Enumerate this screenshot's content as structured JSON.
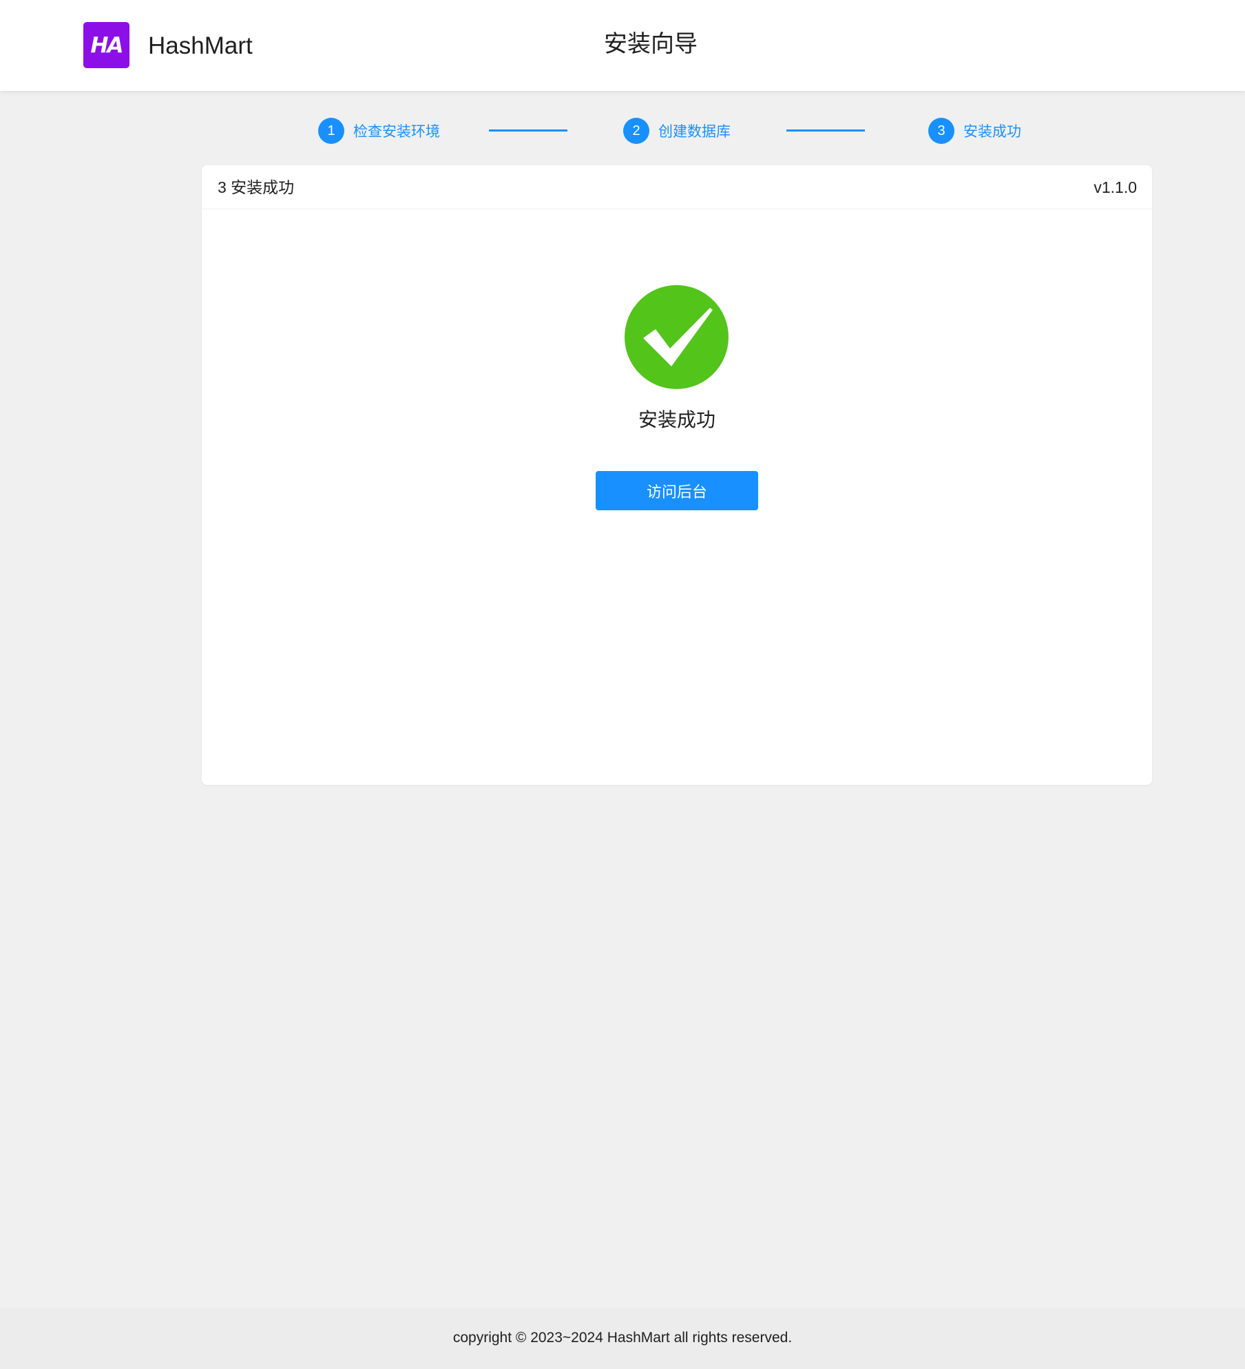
{
  "header": {
    "logo_text": "HA",
    "brand": "HashMart",
    "title": "安装向导"
  },
  "steps": [
    {
      "number": "1",
      "label": "检查安装环境"
    },
    {
      "number": "2",
      "label": "创建数据库"
    },
    {
      "number": "3",
      "label": "安装成功"
    }
  ],
  "card": {
    "title": "3 安装成功",
    "version": "v1.1.0",
    "success_text": "安装成功",
    "button_label": "访问后台"
  },
  "footer": {
    "copyright": "copyright © 2023~2024 HashMart all rights reserved."
  },
  "icons": {
    "success": "check-circle-icon"
  },
  "colors": {
    "primary": "#1890ff",
    "success": "#52c41a",
    "logo": "#8d0fe8"
  }
}
